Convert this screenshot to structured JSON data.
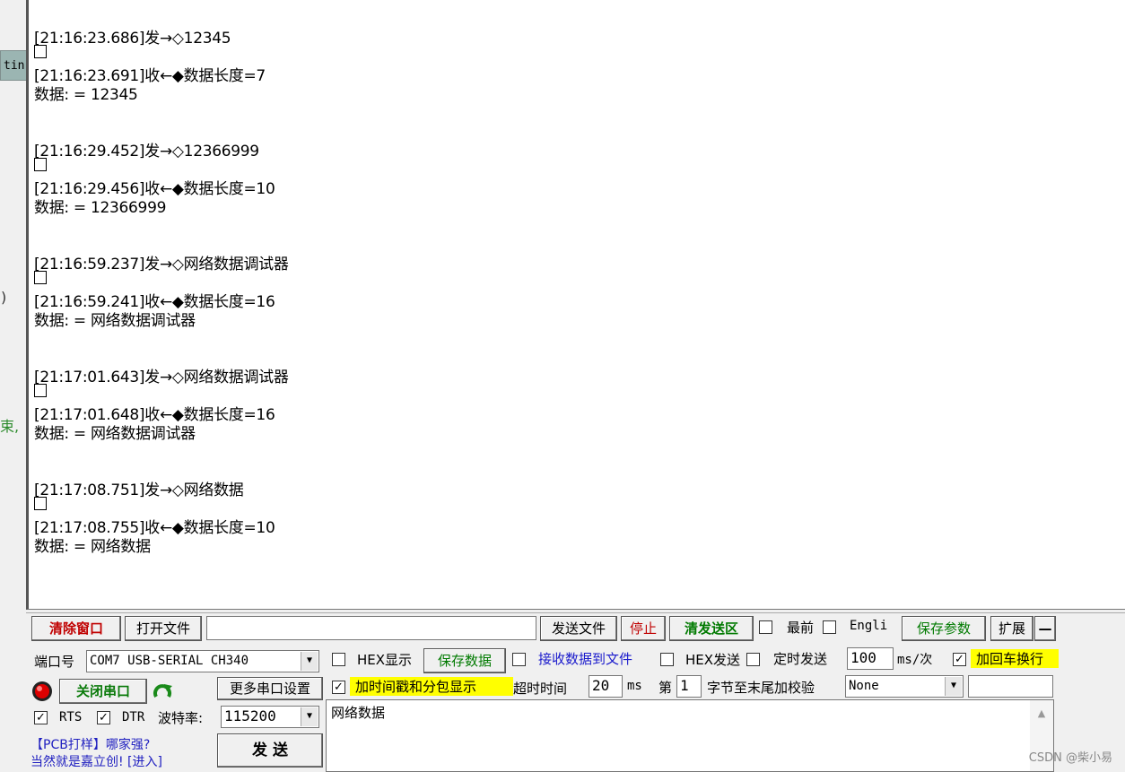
{
  "background_window": {
    "tab_label": "tin",
    "fragment_paren": ")",
    "fragment_green": "束,"
  },
  "receive_log": [
    {
      "type": "send",
      "text": "[21:16:23.686]发→◇12345"
    },
    {
      "type": "recv",
      "text": "[21:16:23.691]收←◆数据长度=7"
    },
    {
      "type": "data",
      "text": "数据:  = 12345"
    },
    {
      "type": "send",
      "text": "[21:16:29.452]发→◇12366999"
    },
    {
      "type": "recv",
      "text": "[21:16:29.456]收←◆数据长度=10"
    },
    {
      "type": "data",
      "text": "数据:  = 12366999"
    },
    {
      "type": "send",
      "text": "[21:16:59.237]发→◇网络数据调试器"
    },
    {
      "type": "recv",
      "text": "[21:16:59.241]收←◆数据长度=16"
    },
    {
      "type": "data",
      "text": "数据:  = 网络数据调试器"
    },
    {
      "type": "send",
      "text": "[21:17:01.643]发→◇网络数据调试器"
    },
    {
      "type": "recv",
      "text": "[21:17:01.648]收←◆数据长度=16"
    },
    {
      "type": "data",
      "text": "数据:  = 网络数据调试器"
    },
    {
      "type": "send",
      "text": "[21:17:08.751]发→◇网络数据"
    },
    {
      "type": "recv",
      "text": "[21:17:08.755]收←◆数据长度=10"
    },
    {
      "type": "data",
      "text": "数据:  = 网络数据"
    }
  ],
  "toolbar": {
    "clear_window": "清除窗口",
    "open_file": "打开文件",
    "file_path": "",
    "send_file": "发送文件",
    "stop": "停止",
    "clear_send": "清发送区",
    "topmost": "最前",
    "english": "Engli",
    "save_params": "保存参数",
    "expand": "扩展",
    "collapse": "—"
  },
  "port_panel": {
    "port_label": "端口号",
    "port_value": "COM7 USB-SERIAL CH340",
    "close_port": "关闭串口",
    "more_settings": "更多串口设置",
    "rts": "RTS",
    "dtr": "DTR",
    "baud_label": "波特率:",
    "baud_value": "115200",
    "ad_line1": "【PCB打样】哪家强?",
    "ad_line2": "当然就是嘉立创! [进入]",
    "send_button": "发  送"
  },
  "recv_options": {
    "hex_display": "HEX显示",
    "save_data": "保存数据",
    "recv_to_file": "接收数据到文件",
    "timestamp": "加时间戳和分包显示",
    "timeout_label": "超时时间",
    "timeout_value": "20",
    "timeout_unit": "ms"
  },
  "send_options": {
    "hex_send": "HEX发送",
    "timed_send": "定时发送",
    "interval_value": "100",
    "interval_unit": "ms/次",
    "add_crlf": "加回车换行",
    "byte_prefix": "第",
    "byte_value": "1",
    "byte_suffix": "字节至末尾加校验",
    "checksum_value": "None"
  },
  "send_text": "网络数据",
  "watermark": "CSDN @柴小易",
  "colors": {
    "highlight": "#ffff00",
    "accent_red": "#c00000",
    "accent_green": "#007a00"
  }
}
